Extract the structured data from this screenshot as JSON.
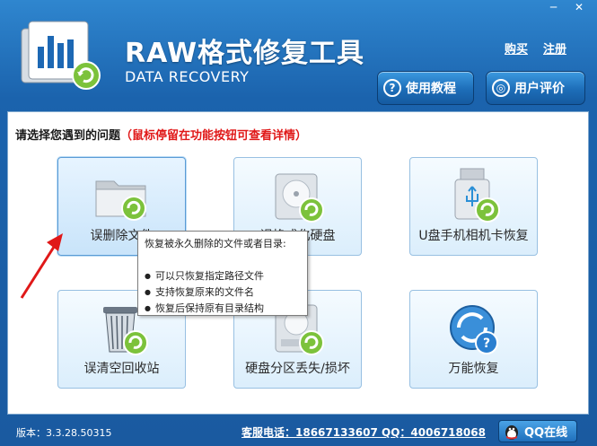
{
  "window": {
    "minimize_icon": "minimize-icon",
    "close_icon": "close-icon",
    "minimize_glyph": "─",
    "close_glyph": "✕"
  },
  "header": {
    "title": "RAW格式修复工具",
    "subtitle": "DATA RECOVERY",
    "links": {
      "buy": "购买",
      "register": "注册"
    },
    "buttons": {
      "tutorial": "使用教程",
      "review": "用户评价"
    }
  },
  "main": {
    "prompt": "请选择您遇到的问题",
    "hint": "（鼠标停留在功能按钮可查看详情）",
    "cards": [
      {
        "label": "误删除文件",
        "icon": "folder-recover-icon"
      },
      {
        "label": "误格式化硬盘",
        "icon": "harddisk-recover-icon"
      },
      {
        "label": "U盘手机相机卡恢复",
        "icon": "usb-drive-recover-icon"
      },
      {
        "label": "误清空回收站",
        "icon": "recycle-bin-recover-icon"
      },
      {
        "label": "硬盘分区丢失/损坏",
        "icon": "partition-recover-icon"
      },
      {
        "label": "万能恢复",
        "icon": "universal-recover-icon"
      }
    ],
    "tooltip": {
      "title": "恢复被永久删除的文件或者目录:",
      "bullets": [
        "可以只恢复指定路径文件",
        "支持恢复原来的文件名",
        "恢复后保持原有目录结构"
      ]
    }
  },
  "footer": {
    "version": "版本：3.3.28.50315",
    "contact": "客服电话：18667133607 QQ：4006718068",
    "qq_button": "QQ在线"
  },
  "colors": {
    "accent": "#1b63ad",
    "hint": "#e01818",
    "panel_bg": "#ffffff"
  }
}
